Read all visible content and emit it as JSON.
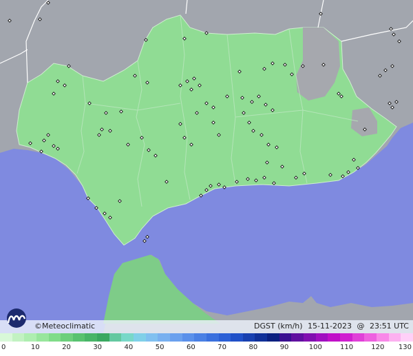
{
  "header": {
    "brand": "Meteoclimatic",
    "copyright_symbol": "©"
  },
  "readout": {
    "variable": "DGST (km/h)",
    "date": "15-11-2023",
    "at": "@",
    "time": "23:51 UTC"
  },
  "legend": {
    "ticks": [
      0,
      10,
      20,
      30,
      40,
      50,
      60,
      70,
      80,
      90,
      100,
      110,
      120,
      130
    ],
    "colors": [
      "#d8f8d8",
      "#c2f2c2",
      "#aeeeb0",
      "#98e69c",
      "#80dc88",
      "#6ccf7c",
      "#58c270",
      "#48b568",
      "#3aa860",
      "#64c8a0",
      "#78d8c8",
      "#80d0e8",
      "#80c0f0",
      "#78b0f0",
      "#6aa0ee",
      "#5a90ea",
      "#4a80e4",
      "#3a70de",
      "#2c60d6",
      "#2050c8",
      "#1840b0",
      "#103098",
      "#0a2080",
      "#3a1090",
      "#6010a0",
      "#8010b0",
      "#a010c0",
      "#c010c8",
      "#d020d0",
      "#e040d8",
      "#ee60e0",
      "#f888e8",
      "#fcb0f0",
      "#ffd0f8"
    ]
  },
  "colors": {
    "sea": "#7f8ae0",
    "land_outside": "#9ca0a8",
    "region_fill": "#90dc94",
    "station_marker": "#ffffff"
  }
}
